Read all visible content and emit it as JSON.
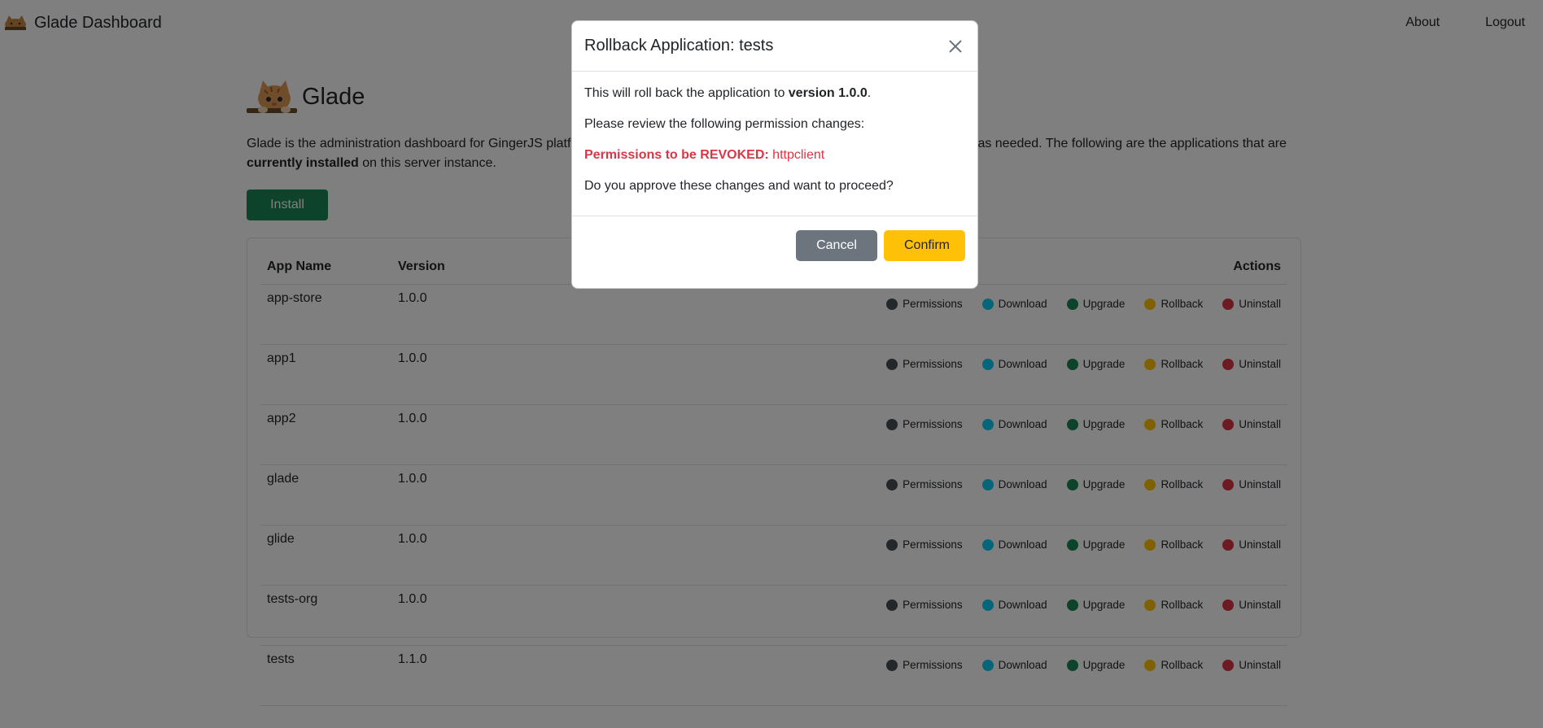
{
  "navbar": {
    "brand": "Glade Dashboard",
    "links": [
      "About",
      "Logout"
    ]
  },
  "page": {
    "title": "Glade",
    "intro_part1": "Glade is the administration dashboard for GingerJS platf",
    "intro_part2": "as needed. The following are the applications that are",
    "intro_bold": "currently installed",
    "intro_part3": " on this server instance.",
    "install_label": "Install"
  },
  "table": {
    "headers": {
      "name": "App Name",
      "version": "Version",
      "actions": "Actions"
    },
    "actions": [
      {
        "label": "Permissions",
        "color": "#495057"
      },
      {
        "label": "Download",
        "color": "#0dcaf0"
      },
      {
        "label": "Upgrade",
        "color": "#198754"
      },
      {
        "label": "Rollback",
        "color": "#ffc107"
      },
      {
        "label": "Uninstall",
        "color": "#dc3545"
      }
    ],
    "rows": [
      {
        "name": "app-store",
        "version": "1.0.0"
      },
      {
        "name": "app1",
        "version": "1.0.0"
      },
      {
        "name": "app2",
        "version": "1.0.0"
      },
      {
        "name": "glade",
        "version": "1.0.0"
      },
      {
        "name": "glide",
        "version": "1.0.0"
      },
      {
        "name": "tests-org",
        "version": "1.0.0"
      },
      {
        "name": "tests",
        "version": "1.1.0"
      }
    ]
  },
  "modal": {
    "title": "Rollback Application: tests",
    "line1_prefix": "This will roll back the application to ",
    "line1_version": "version 1.0.0",
    "line1_suffix": ".",
    "line2": "Please review the following permission changes:",
    "revoked_label": "Permissions to be REVOKED:",
    "revoked_value": "httpclient",
    "line4": "Do you approve these changes and want to proceed?",
    "cancel_label": "Cancel",
    "confirm_label": "Confirm"
  }
}
